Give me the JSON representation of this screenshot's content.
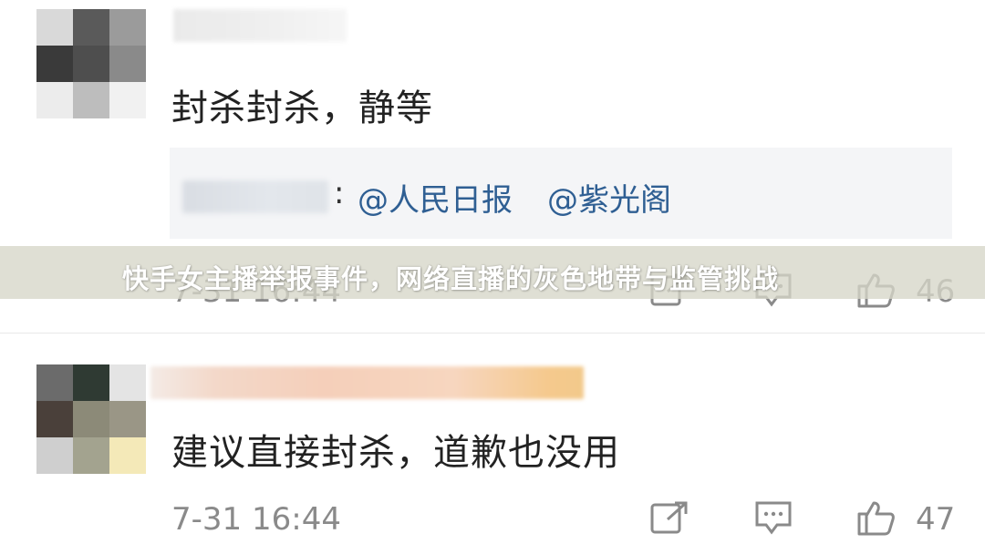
{
  "comments": [
    {
      "body": "封杀封杀，静等",
      "reply": {
        "separator": ":",
        "mentions": [
          "@人民日报",
          "@紫光阁"
        ]
      },
      "timestamp": "7-31 16:44",
      "likes": "46"
    },
    {
      "body": "建议直接封杀，道歉也没用",
      "timestamp": "7-31 16:44",
      "likes": "47"
    }
  ],
  "banner": {
    "title": "快手女主播举报事件，网络直播的灰色地带与监管挑战"
  },
  "icons": {
    "share": "share-square-arrow-icon",
    "reply": "comment-bubble-icon",
    "like": "thumbs-up-icon"
  },
  "colors": {
    "mention": "#2f5f93",
    "meta_text": "#8a8a8a",
    "reply_bg": "#f4f5f7",
    "banner_bg": "#d6d6c8"
  }
}
